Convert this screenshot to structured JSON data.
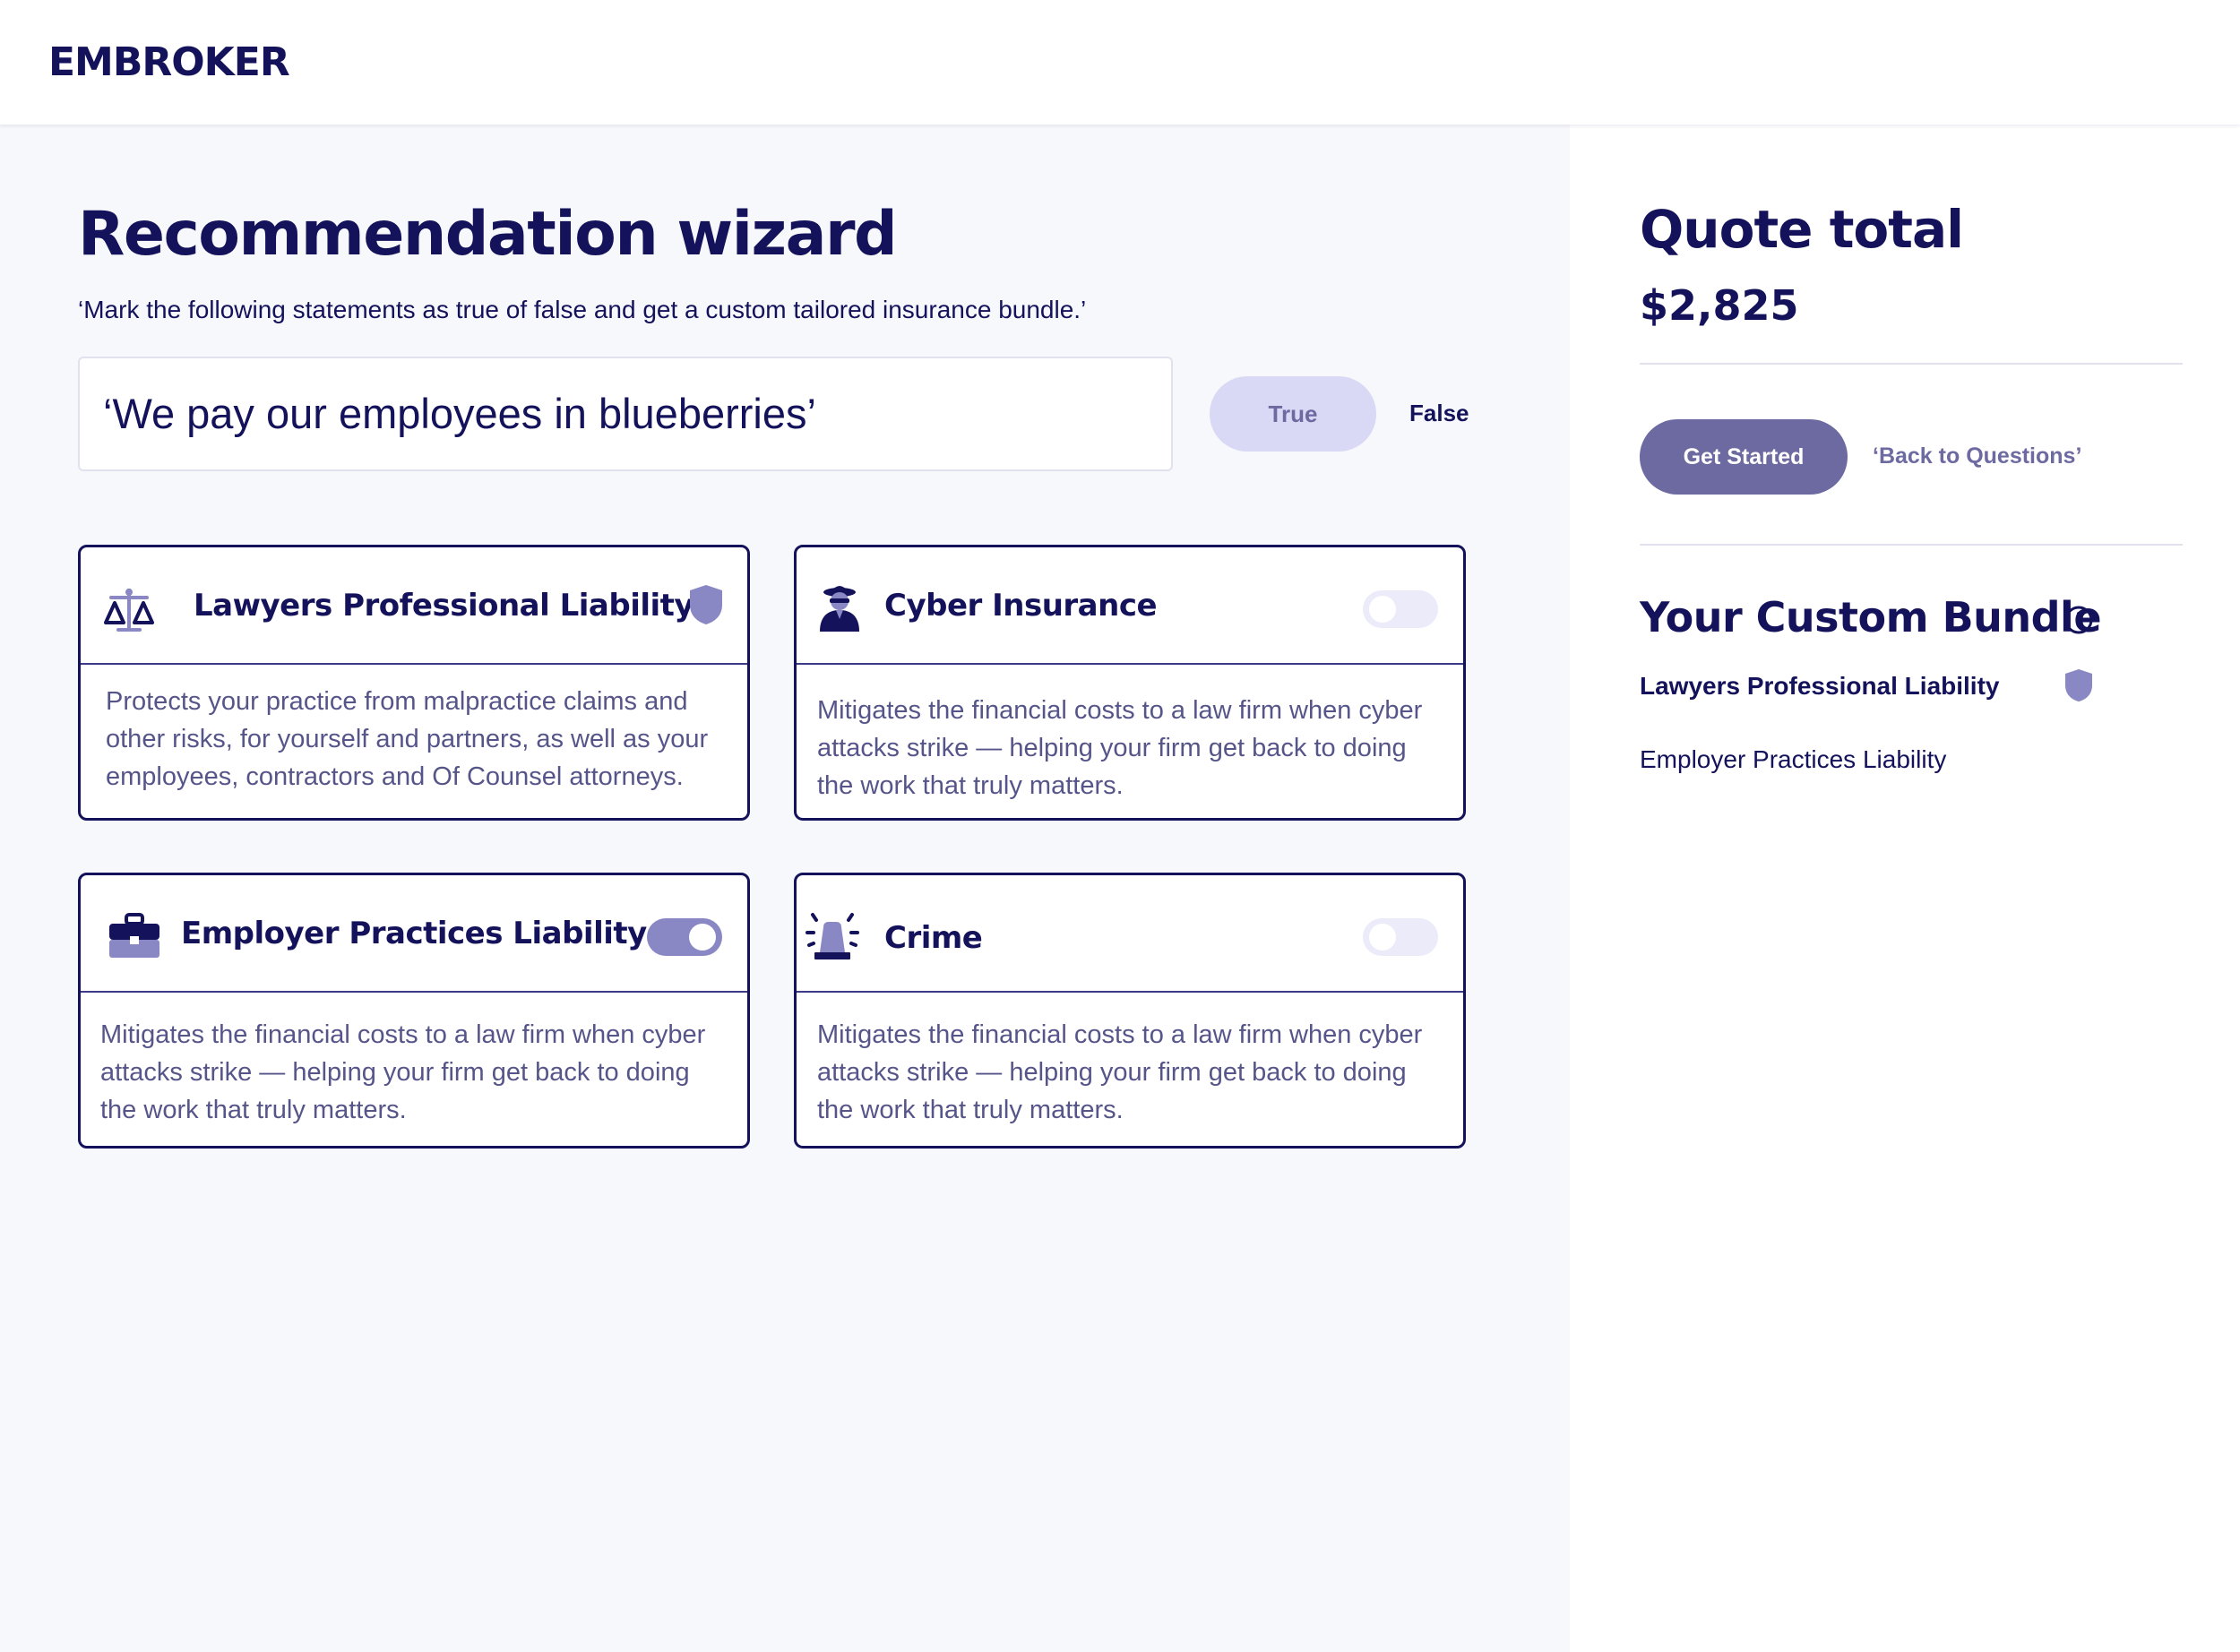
{
  "header": {
    "logo": "EMBROKER"
  },
  "wizard": {
    "title": "Recommendation wizard",
    "subtitle": "‘Mark the following statements as true of false and get a custom tailored insurance bundle.’",
    "statement": "‘We pay our employees in blueberries’",
    "true_label": "True",
    "false_label": "False"
  },
  "cards": [
    {
      "title": "Lawyers Professional Liability",
      "icon": "scales-icon",
      "status": "included-shield",
      "description": "Protects your practice from malpractice claims and other risks, for yourself and partners, as well as your employees, contractors and Of Counsel attorneys."
    },
    {
      "title": "Cyber Insurance",
      "icon": "hacker-icon",
      "toggle_on": false,
      "description": "Mitigates the financial costs to a law firm when cyber attacks strike — helping your firm get back to doing the work that truly matters."
    },
    {
      "title": "Employer Practices Liability",
      "icon": "briefcase-icon",
      "toggle_on": true,
      "description": "Mitigates the financial costs to a law firm when cyber attacks strike — helping your firm get back to doing the work that truly matters."
    },
    {
      "title": "Crime",
      "icon": "siren-icon",
      "toggle_on": false,
      "description": "Mitigates the financial costs to a law firm when cyber attacks strike — helping your firm get back to doing the work that truly matters."
    }
  ],
  "quote": {
    "title": "Quote total",
    "amount": "$2,825",
    "get_started": "Get Started",
    "back": "‘Back to Questions’"
  },
  "bundle": {
    "title": "Your Custom Bundle",
    "items": [
      {
        "label": "Lawyers Professional Liability",
        "locked": true
      },
      {
        "label": "Employer Practices Liability",
        "locked": false
      }
    ]
  },
  "colors": {
    "navy": "#14125a",
    "muted_purple": "#6c6aa1",
    "lavender": "#d9d9f5",
    "panel_bg": "#f7f8fc"
  }
}
